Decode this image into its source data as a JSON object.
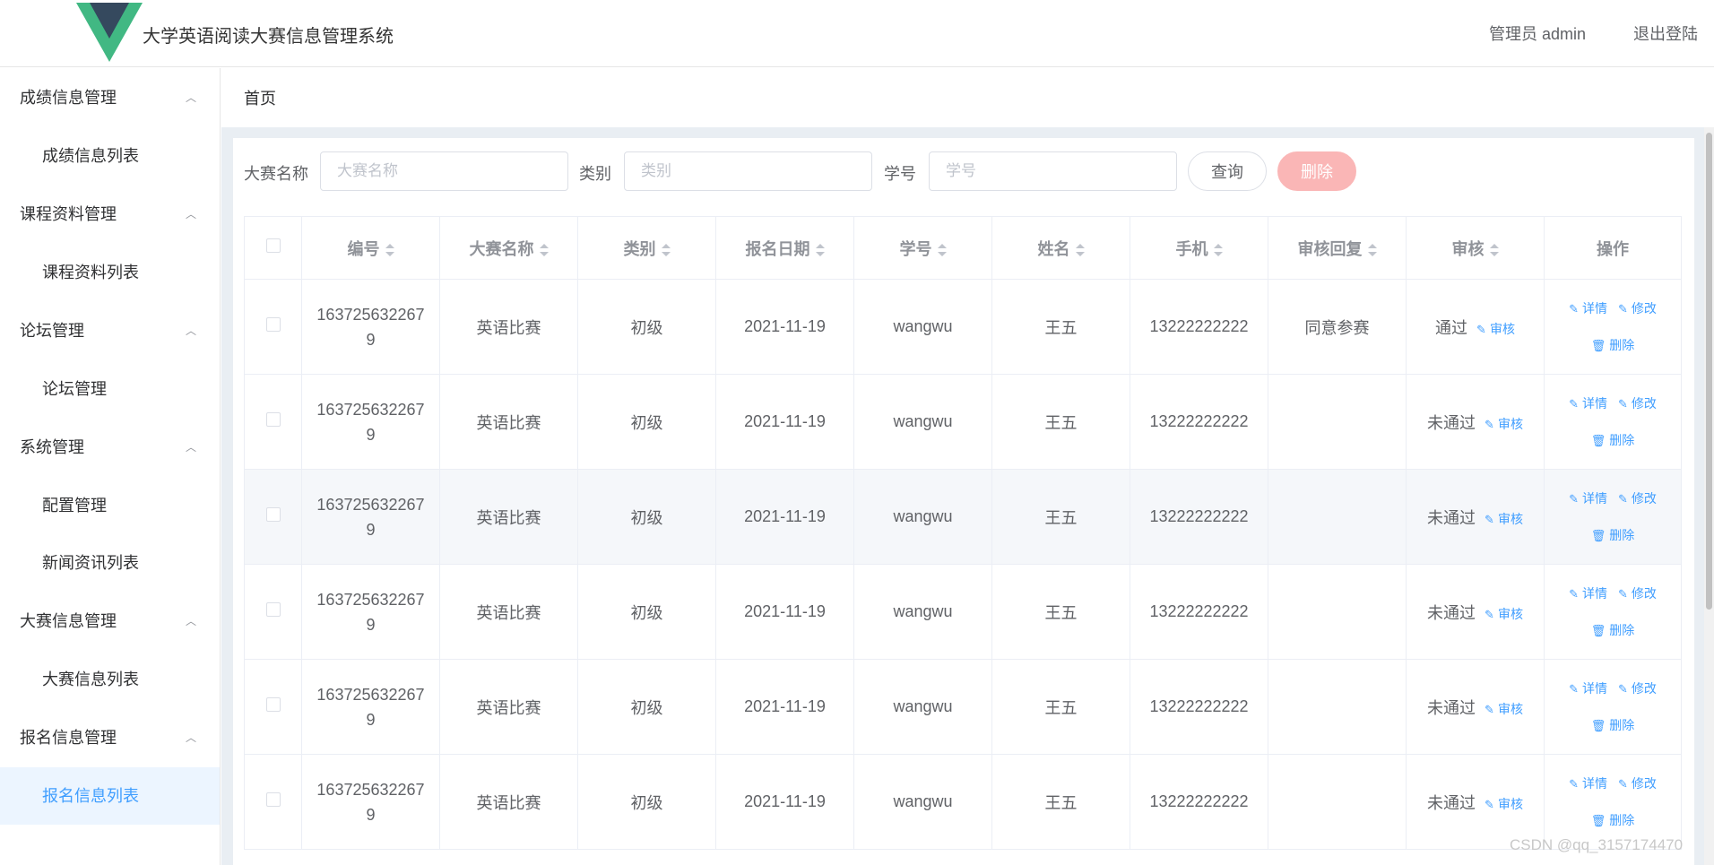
{
  "header": {
    "title": "大学英语阅读大赛信息管理系统",
    "user": "管理员 admin",
    "logout": "退出登陆"
  },
  "sidebar": {
    "groups": [
      {
        "label": "成绩信息管理",
        "items": [
          "成绩信息列表"
        ]
      },
      {
        "label": "课程资料管理",
        "items": [
          "课程资料列表"
        ]
      },
      {
        "label": "论坛管理",
        "items": [
          "论坛管理"
        ]
      },
      {
        "label": "系统管理",
        "items": [
          "配置管理",
          "新闻资讯列表"
        ]
      },
      {
        "label": "大赛信息管理",
        "items": [
          "大赛信息列表"
        ]
      },
      {
        "label": "报名信息管理",
        "items": [
          "报名信息列表"
        ]
      }
    ],
    "active_item": "报名信息列表"
  },
  "breadcrumb": "首页",
  "search": {
    "name_label": "大赛名称",
    "name_placeholder": "大赛名称",
    "type_label": "类别",
    "type_placeholder": "类别",
    "sid_label": "学号",
    "sid_placeholder": "学号",
    "query": "查询",
    "delete": "删除"
  },
  "table": {
    "columns": [
      "编号",
      "大赛名称",
      "类别",
      "报名日期",
      "学号",
      "姓名",
      "手机",
      "审核回复",
      "审核",
      "操作"
    ],
    "rows": [
      {
        "id": "1637256322679",
        "contest": "英语比赛",
        "type": "初级",
        "date": "2021-11-19",
        "sid": "wangwu",
        "name": "王五",
        "phone": "13222222222",
        "reply": "同意参赛",
        "status": "通过"
      },
      {
        "id": "1637256322679",
        "contest": "英语比赛",
        "type": "初级",
        "date": "2021-11-19",
        "sid": "wangwu",
        "name": "王五",
        "phone": "13222222222",
        "reply": "",
        "status": "未通过"
      },
      {
        "id": "1637256322679",
        "contest": "英语比赛",
        "type": "初级",
        "date": "2021-11-19",
        "sid": "wangwu",
        "name": "王五",
        "phone": "13222222222",
        "reply": "",
        "status": "未通过"
      },
      {
        "id": "1637256322679",
        "contest": "英语比赛",
        "type": "初级",
        "date": "2021-11-19",
        "sid": "wangwu",
        "name": "王五",
        "phone": "13222222222",
        "reply": "",
        "status": "未通过"
      },
      {
        "id": "1637256322679",
        "contest": "英语比赛",
        "type": "初级",
        "date": "2021-11-19",
        "sid": "wangwu",
        "name": "王五",
        "phone": "13222222222",
        "reply": "",
        "status": "未通过"
      },
      {
        "id": "1637256322679",
        "contest": "英语比赛",
        "type": "初级",
        "date": "2021-11-19",
        "sid": "wangwu",
        "name": "王五",
        "phone": "13222222222",
        "reply": "",
        "status": "未通过"
      }
    ],
    "actions": {
      "audit": "审核",
      "detail": "详情",
      "edit": "修改",
      "delete": "删除"
    }
  },
  "watermark": "CSDN @qq_3157174470",
  "colors": {
    "primary": "#409eff",
    "danger_light": "#fab6b6",
    "logo_green": "#41b883",
    "logo_dark": "#35495e"
  }
}
